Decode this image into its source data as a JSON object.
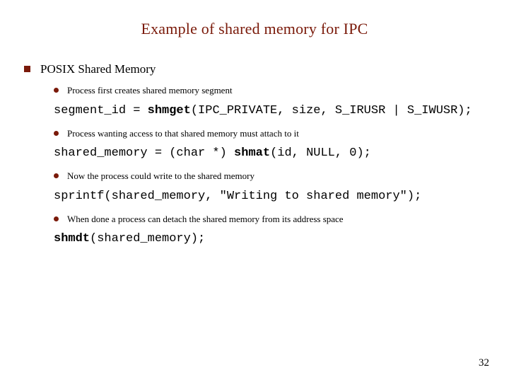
{
  "title": "Example of shared memory for IPC",
  "heading1": "POSIX Shared Memory",
  "bullets": {
    "b1": "Process first creates shared memory segment",
    "b2": "Process wanting access to that shared memory must attach to it",
    "b3": "Now the process could write to the shared memory",
    "b4": "When done a process can detach the shared memory from its address space"
  },
  "code": {
    "c1a": "segment_id = ",
    "c1b": "shmget",
    "c1c": "(IPC_PRIVATE, size, S_IRUSR | S_IWUSR);",
    "c2a": "shared_memory = (char *) ",
    "c2b": "shmat",
    "c2c": "(id, NULL, 0);",
    "c3a": "sprintf(shared_memory, \"Writing to shared memory\");",
    "c4a": "shmdt",
    "c4b": "(shared_memory);"
  },
  "pagenum": "32"
}
